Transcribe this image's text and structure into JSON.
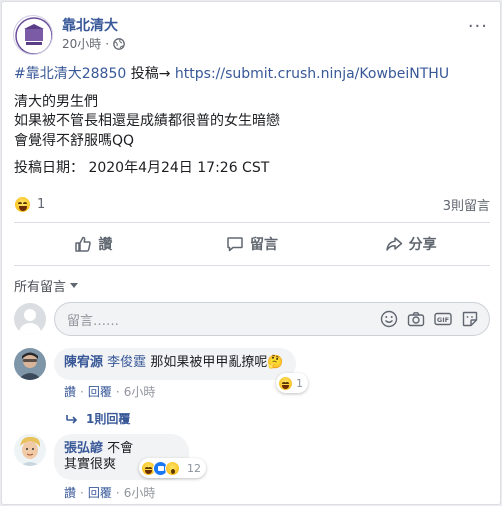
{
  "post": {
    "page_name": "靠北清大",
    "time": "20小時",
    "dot": "·",
    "more": "···",
    "hashtag": "#靠北清大28850",
    "submit_text": "投稿→",
    "link": "https://submit.crush.ninja/KowbeiNTHU",
    "lines": [
      "清大的男生們",
      "如果被不管長相還是成績都很普的女生暗戀",
      "會覺得不舒服嗎QQ"
    ],
    "date_line": "投稿日期： 2020年4月24日 17:26 CST"
  },
  "reactions": {
    "count": "1",
    "comments_count": "3則留言"
  },
  "actions": {
    "like": "讚",
    "comment": "留言",
    "share": "分享"
  },
  "comments_section": {
    "sort_label": "所有留言",
    "placeholder": "留言……"
  },
  "comments": [
    {
      "author": "陳宥源",
      "mention": "李俊霆",
      "text": "那如果被甲甲亂撩呢🤔",
      "reaction_count": "1",
      "like": "讚",
      "reply": "回覆",
      "time": "6小時",
      "replies_link": "1則回覆"
    },
    {
      "author": "張弘諺",
      "text_inline": "不會",
      "text_second": "其實很爽",
      "reaction_count": "12",
      "like": "讚",
      "reply": "回覆",
      "time": "6小時"
    }
  ],
  "colors": {
    "link": "#385898",
    "muted": "#606770",
    "bubble": "#f2f3f5"
  }
}
